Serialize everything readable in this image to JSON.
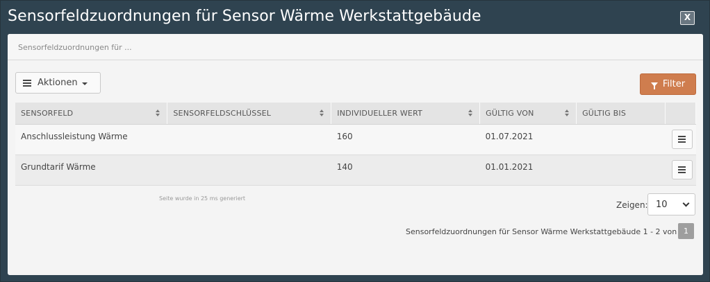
{
  "modal": {
    "title": "Sensorfeldzuordnungen für Sensor Wärme Werkstattgebäude",
    "close_label": "X"
  },
  "breadcrumb": "Sensorfeldzuordnungen für ...",
  "toolbar": {
    "actions_label": "Aktionen",
    "filter_label": "Filter"
  },
  "table": {
    "columns": [
      "SENSORFELD",
      "SENSORFELDSCHLÜSSEL",
      "INDIVIDUELLER WERT",
      "GÜLTIG VON",
      "GÜLTIG BIS"
    ],
    "rows": [
      {
        "sensorfeld": "Anschlussleistung Wärme",
        "schluessel": "",
        "wert": "160",
        "von": "01.07.2021",
        "bis": ""
      },
      {
        "sensorfeld": "Grundtarif Wärme",
        "schluessel": "",
        "wert": "140",
        "von": "01.01.2021",
        "bis": ""
      }
    ]
  },
  "footer": {
    "generated": "Seite wurde in 25 ms generiert",
    "show_label": "Zeigen:",
    "page_size": "10",
    "pager_text": "Sensorfeldzuordnungen für Sensor Wärme Werkstattgebäude 1 - 2 von 2",
    "current_page": "1"
  },
  "colors": {
    "header_bg": "#2f4350",
    "filter_button": "#cf7d4e",
    "page_button": "#9e9e9e"
  }
}
